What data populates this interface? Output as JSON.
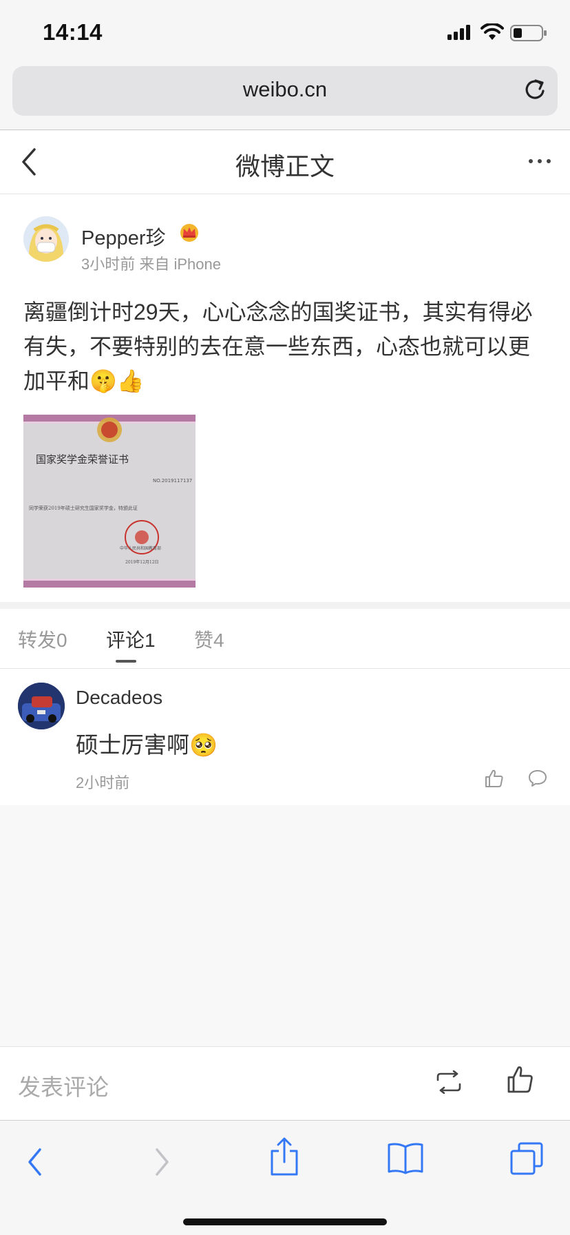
{
  "status_bar": {
    "time": "14:14"
  },
  "browser": {
    "url": "weibo.cn"
  },
  "nav": {
    "title": "微博正文"
  },
  "post": {
    "author": "Pepper珍",
    "meta": "3小时前 来自 iPhone",
    "text": "离疆倒计时29天，心心念念的国奖证书，其实有得必有失，不要特别的去在意一些东西，心态也就可以更加平和",
    "emojis": [
      "🤫",
      "👍"
    ],
    "image": {
      "heading": "国家奖学金荣誉证书",
      "number": "NO.2019117137",
      "body": "同学荣获2019年硕士研究生国家奖学金，特颁此证",
      "issuer": "中华人民共和国教育部",
      "date": "2019年12月12日"
    }
  },
  "tabs": {
    "repost": "转发0",
    "comment": "评论1",
    "like": "赞4"
  },
  "comments": [
    {
      "name": "Decadeos",
      "text": "硕士厉害啊",
      "emoji": "🥺",
      "time": "2小时前"
    }
  ],
  "compose": {
    "placeholder": "发表评论"
  },
  "colors": {
    "accent": "#3478f6",
    "text_primary": "#333333",
    "text_secondary": "#999999",
    "background": "#f8f8f8"
  },
  "icons": [
    "signal-icon",
    "wifi-icon",
    "battery-icon",
    "reload-icon",
    "back-arrow-icon",
    "more-icon",
    "crown-icon",
    "thumbs-up-icon",
    "comment-bubble-icon",
    "repost-icon",
    "share-icon",
    "bookmarks-icon",
    "tabs-icon"
  ]
}
